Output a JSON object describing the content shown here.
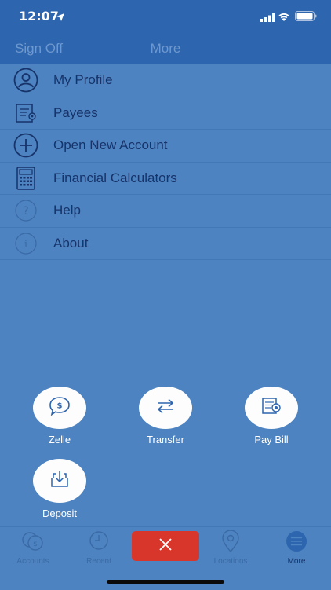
{
  "status": {
    "time": "12:07"
  },
  "nav": {
    "left_label": "Sign Off",
    "title": "More"
  },
  "menu": {
    "items": [
      {
        "label": "My Profile",
        "icon": "profile-icon"
      },
      {
        "label": "Payees",
        "icon": "payees-icon"
      },
      {
        "label": "Open New Account",
        "icon": "add-circle-icon"
      },
      {
        "label": "Financial Calculators",
        "icon": "calculator-icon"
      },
      {
        "label": "Help",
        "icon": "help-icon"
      },
      {
        "label": "About",
        "icon": "info-icon"
      }
    ]
  },
  "actions": {
    "zelle": "Zelle",
    "transfer": "Transfer",
    "pay_bill": "Pay Bill",
    "deposit": "Deposit"
  },
  "tabs": {
    "accounts": "Accounts",
    "accounts_badge": "$",
    "recent": "Recent",
    "locations": "Locations",
    "more": "More"
  },
  "colors": {
    "overlay": "#4c83c0",
    "header": "#2d65af",
    "close": "#d9362b",
    "text_dark": "#17336a"
  }
}
